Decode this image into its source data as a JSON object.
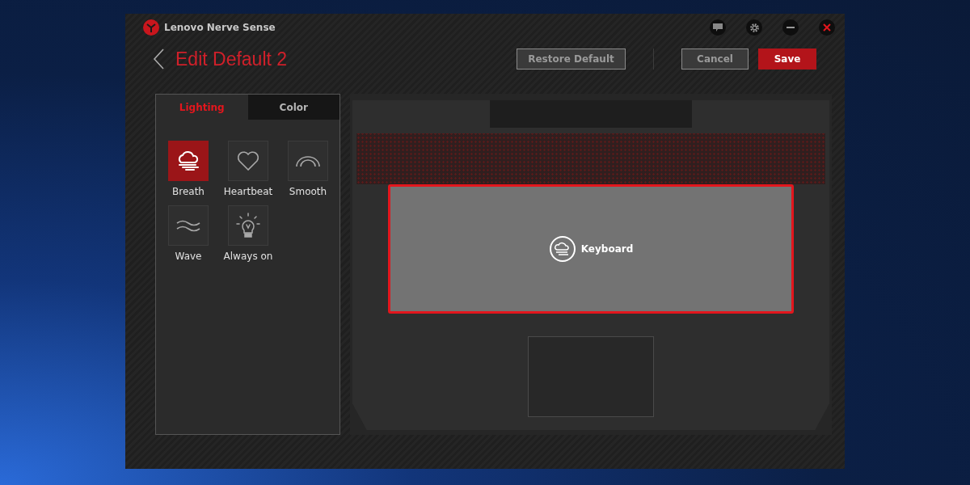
{
  "window": {
    "title": "Lenovo Nerve Sense"
  },
  "header": {
    "title": "Edit Default 2",
    "buttons": [
      {
        "label": "Restore Default",
        "kind": "secondary"
      },
      {
        "label": "Cancel",
        "kind": "secondary"
      },
      {
        "label": "Save",
        "kind": "primary"
      }
    ]
  },
  "tabs": [
    {
      "label": "Lighting",
      "selected": true
    },
    {
      "label": "Color",
      "selected": false
    }
  ],
  "effects": [
    {
      "label": "Breath",
      "kind": "breath",
      "selected": true
    },
    {
      "label": "Heartbeat",
      "kind": "heartbeat",
      "selected": false
    },
    {
      "label": "Smooth",
      "kind": "smooth",
      "selected": false
    },
    {
      "label": "Wave",
      "kind": "wave",
      "selected": false
    },
    {
      "label": "Always on",
      "kind": "always_on",
      "selected": false
    }
  ],
  "zone": {
    "label": "Keyboard",
    "selected": true
  }
}
